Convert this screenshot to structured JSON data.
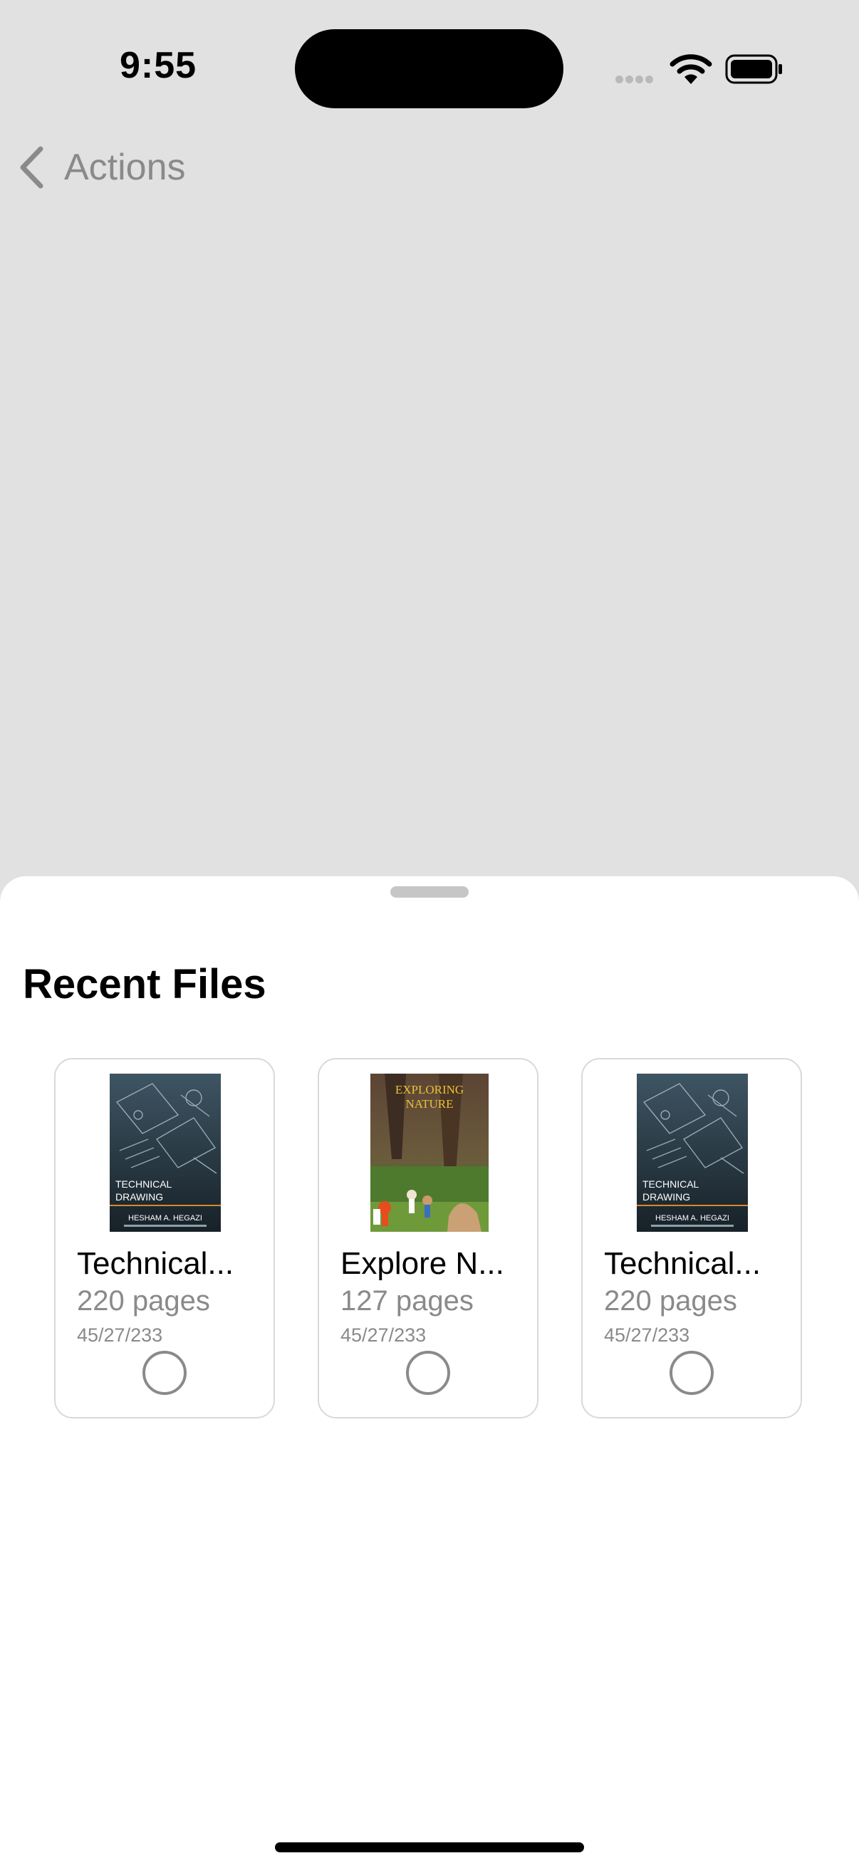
{
  "status_bar": {
    "time": "9:55"
  },
  "nav": {
    "back_label": "Actions"
  },
  "sheet": {
    "title": "Recent Files",
    "files": [
      {
        "title": "Technical...",
        "pages": "220 pages",
        "date": "45/27/233",
        "cover": {
          "line1": "TECHNICAL",
          "line2": "DRAWING",
          "author": "HESHAM A. HEGAZI"
        }
      },
      {
        "title": "Explore N...",
        "pages": "127 pages",
        "date": "45/27/233",
        "cover": {
          "line1": "EXPLORING",
          "line2": "NATURE"
        }
      },
      {
        "title": "Technical...",
        "pages": "220 pages",
        "date": "45/27/233",
        "cover": {
          "line1": "TECHNICAL",
          "line2": "DRAWING",
          "author": "HESHAM A. HEGAZI"
        }
      }
    ]
  },
  "colors": {
    "background": "#e1e1e1",
    "sheet": "#ffffff",
    "secondary_text": "#8a8a8a",
    "card_border": "#d9d9d9",
    "tech_cover": "#2d3c44",
    "nature_title": "#e9c23a"
  },
  "icons": {
    "back": "chevron-left-icon",
    "wifi": "wifi-icon",
    "battery": "battery-icon",
    "signal": "cellular-signal-icon",
    "select": "radio-circle-icon"
  }
}
